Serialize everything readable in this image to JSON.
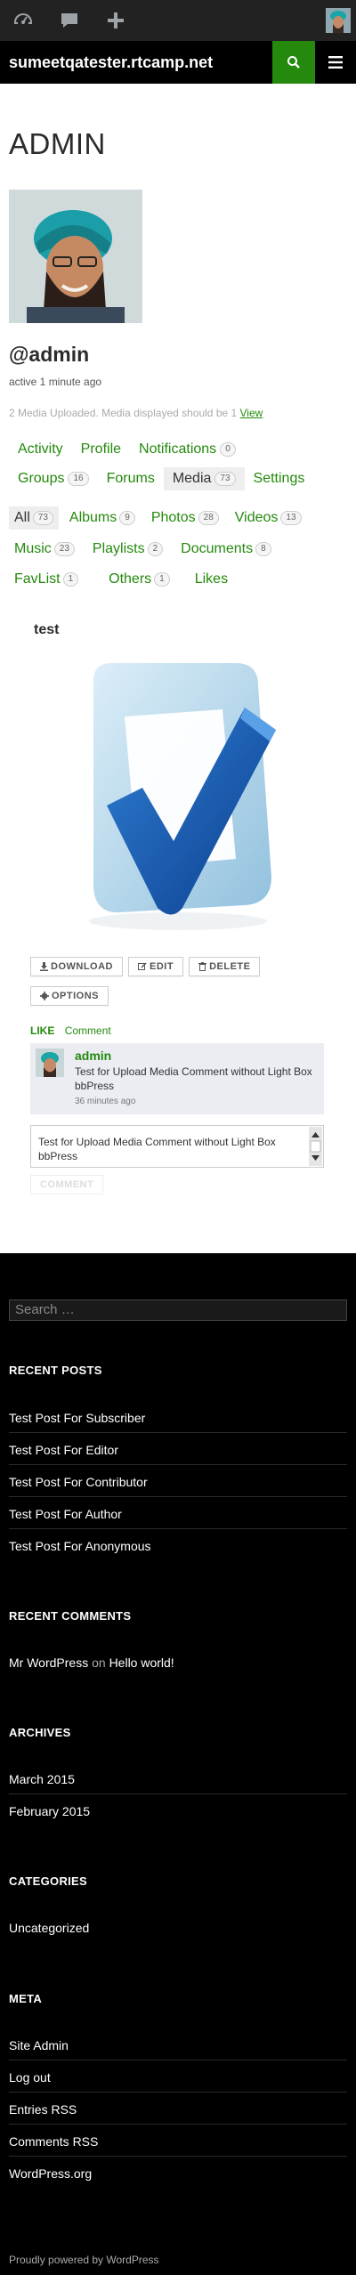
{
  "admin_bar": {
    "items": [
      {
        "name": "dashboard-icon"
      },
      {
        "name": "comments-icon"
      },
      {
        "name": "new-content-icon"
      }
    ]
  },
  "site": {
    "title": "sumeetqatester.rtcamp.net"
  },
  "profile": {
    "page_title": "ADMIN",
    "handle": "@admin",
    "activity": "active 1 minute ago",
    "media_note": "2 Media Uploaded. Media displayed should be 1 ",
    "media_note_link": "View"
  },
  "nav": {
    "row1": [
      {
        "label": "Activity",
        "count": null
      },
      {
        "label": "Profile",
        "count": null
      },
      {
        "label": "Notifications",
        "count": "0"
      }
    ],
    "row2": [
      {
        "label": "Groups",
        "count": "16"
      },
      {
        "label": "Forums",
        "count": null
      },
      {
        "label": "Media",
        "count": "73",
        "current": true
      },
      {
        "label": "Settings",
        "count": null
      }
    ]
  },
  "subnav": {
    "row1": [
      {
        "label": "All",
        "count": "73",
        "current": true
      },
      {
        "label": "Albums",
        "count": "9"
      },
      {
        "label": "Photos",
        "count": "28"
      },
      {
        "label": "Videos",
        "count": "13"
      }
    ],
    "row2": [
      {
        "label": "Music",
        "count": "23"
      },
      {
        "label": "Playlists",
        "count": "2"
      },
      {
        "label": "Documents",
        "count": "8"
      }
    ],
    "row3": [
      {
        "label": "FavList",
        "count": "1"
      },
      {
        "label": "Others",
        "count": "1"
      },
      {
        "label": "Likes",
        "count": null
      }
    ]
  },
  "media": {
    "title": "test",
    "buttons": {
      "download": "DOWNLOAD",
      "edit": "EDIT",
      "delete": "DELETE",
      "options": "OPTIONS"
    },
    "like_label": "LIKE",
    "comment_link": "Comment",
    "comment": {
      "author": "admin",
      "text": "Test for Upload Media Comment without Light Box bbPress",
      "time": "36 minutes ago"
    },
    "reply_text": "Test for Upload Media Comment without Light Box bbPress",
    "submit_label": "COMMENT"
  },
  "footer": {
    "search_placeholder": "Search …",
    "recent_posts_title": "RECENT POSTS",
    "recent_posts": [
      "Test Post For Subscriber",
      "Test Post For Editor",
      "Test Post For Contributor",
      "Test Post For Author",
      "Test Post For Anonymous"
    ],
    "recent_comments_title": "RECENT COMMENTS",
    "recent_comment": {
      "author": "Mr WordPress",
      "on": "on",
      "post": "Hello world!"
    },
    "archives_title": "ARCHIVES",
    "archives": [
      "March 2015",
      "February 2015"
    ],
    "categories_title": "CATEGORIES",
    "categories": [
      "Uncategorized"
    ],
    "meta_title": "META",
    "meta": [
      "Site Admin",
      "Log out",
      "Entries RSS",
      "Comments RSS",
      "WordPress.org"
    ],
    "credit": "Proudly powered by WordPress"
  },
  "colors": {
    "accent": "#24890d",
    "admin_bar": "#222222",
    "header": "#000000"
  }
}
